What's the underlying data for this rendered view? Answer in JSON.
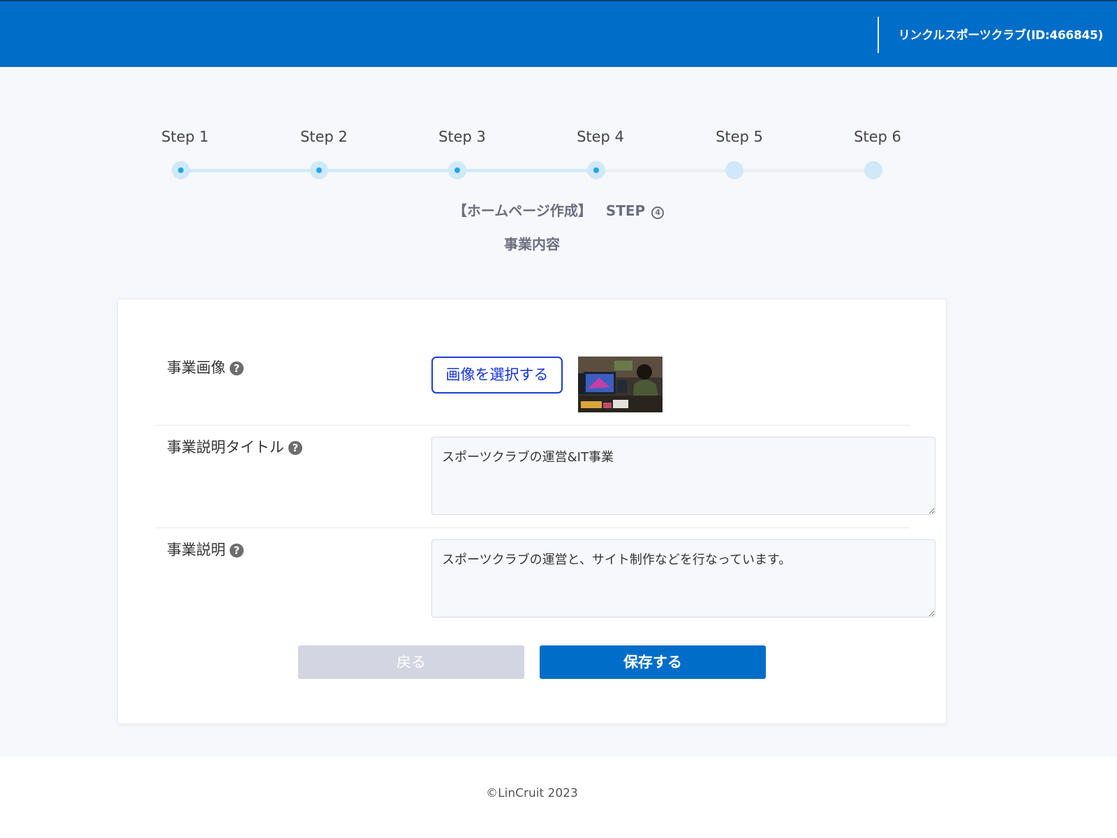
{
  "header": {
    "account_label": "リンクルスポーツクラブ(ID:466845)",
    "background_color": "#006dc9"
  },
  "stepper": {
    "steps": [
      {
        "label": "Step 1",
        "state": "completed"
      },
      {
        "label": "Step 2",
        "state": "completed"
      },
      {
        "label": "Step 3",
        "state": "completed"
      },
      {
        "label": "Step 4",
        "state": "current"
      },
      {
        "label": "Step 5",
        "state": "upcoming"
      },
      {
        "label": "Step 6",
        "state": "upcoming"
      }
    ],
    "completed_color": "#26a3e6",
    "track_color": "#cfe9f8"
  },
  "page": {
    "heading": "【ホームページ作成】",
    "step_tag": "STEP",
    "step_number": "4",
    "subheading": "事業内容"
  },
  "form": {
    "business_image": {
      "label": "事業画像",
      "help_icon": "question-circle-icon",
      "select_button_label": "画像を選択する"
    },
    "business_title": {
      "label": "事業説明タイトル",
      "help_icon": "question-circle-icon",
      "value": "スポーツクラブの運営&IT事業"
    },
    "business_description": {
      "label": "事業説明",
      "help_icon": "question-circle-icon",
      "value": "スポーツクラブの運営と、サイト制作などを行なっています。"
    },
    "back_button_label": "戻る",
    "save_button_label": "保存する"
  },
  "footer": {
    "copyright": "©LinCruit 2023"
  }
}
